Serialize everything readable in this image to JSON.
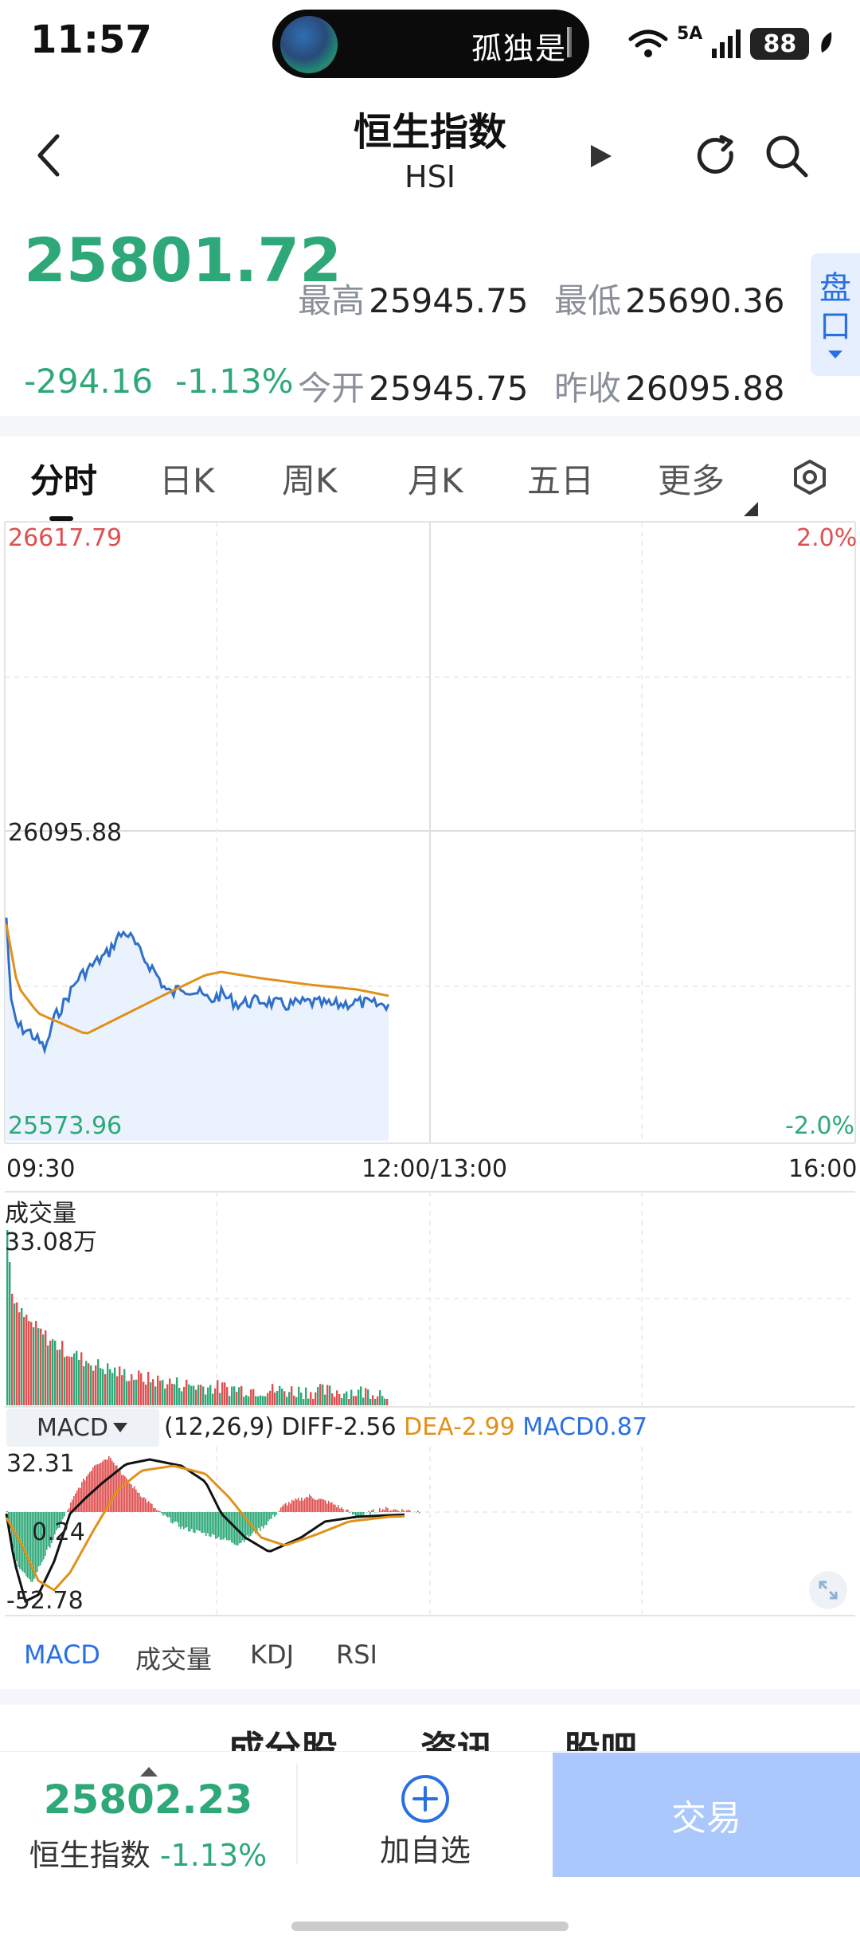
{
  "status": {
    "time": "11:57",
    "island_text": "孤独是",
    "network": "5A",
    "battery": "88"
  },
  "header": {
    "title": "恒生指数",
    "code": "HSI"
  },
  "quote": {
    "price": "25801.72",
    "high_label": "最高",
    "high": "25945.75",
    "low_label": "最低",
    "low": "25690.36",
    "change": "-294.16",
    "change_pct": "-1.13%",
    "open_label": "今开",
    "open": "25945.75",
    "prev_close_label": "昨收",
    "prev_close": "26095.88",
    "pankou": [
      "盘",
      "口"
    ]
  },
  "tabs": [
    "分时",
    "日K",
    "周K",
    "月K",
    "五日",
    "更多"
  ],
  "chart": {
    "y_top": "26617.79",
    "y_top_pct": "2.0%",
    "y_mid": "26095.88",
    "y_bottom": "25573.96",
    "y_bottom_pct": "-2.0%",
    "x_start": "09:30",
    "x_mid": "12:00/13:00",
    "x_end": "16:00",
    "volume_label": "成交量",
    "volume_value": "33.08万",
    "macd_select": "MACD",
    "macd_params": "(12,26,9)",
    "diff": "DIFF-2.56",
    "dea": "DEA-2.99",
    "macd": "MACD0.87",
    "macd_top": "32.31",
    "macd_mid": "0.24",
    "macd_bottom": "-52.78",
    "colors": {
      "up": "#e05050",
      "down": "#2ea878",
      "price_line": "#2f6fca",
      "avg_line": "#e0911a"
    }
  },
  "indicator_tabs": [
    "MACD",
    "成交量",
    "KDJ",
    "RSI"
  ],
  "content_tabs": [
    "成分股",
    "资讯",
    "股吧"
  ],
  "bottom": {
    "price": "25802.23",
    "name": "恒生指数",
    "pct": "-1.13%",
    "add_label": "加自选",
    "trade_label": "交易"
  }
}
